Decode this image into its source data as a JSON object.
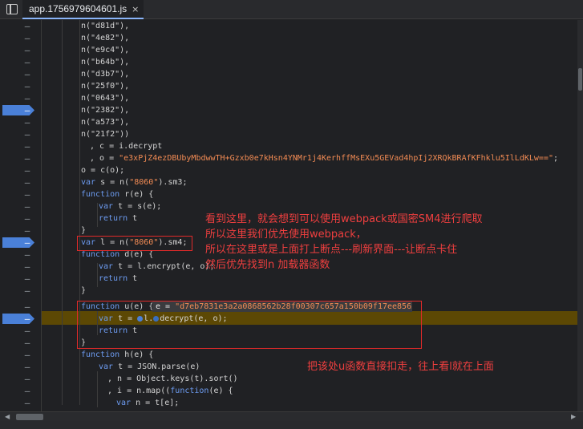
{
  "tab": {
    "filename": "app.1756979604601.js",
    "close_glyph": "×"
  },
  "gutter_mark": "–",
  "code": {
    "l1": "n(\"d81d\"),",
    "l2": "n(\"4e82\"),",
    "l3": "n(\"e9c4\"),",
    "l4": "n(\"b64b\"),",
    "l5": "n(\"d3b7\"),",
    "l6": "n(\"25f0\"),",
    "l7": "n(\"0643\"),",
    "l8": "n(\"2382\"),",
    "l9": "n(\"a573\"),",
    "l10": "n(\"21f2\"))",
    "l11_a": ", c = i.decrypt",
    "l12_a": ", o = ",
    "l12_str": "\"e3xPjZ4ezDBUbyMbdwwTH+Gzxb0e7kHsn4YNMr1j4KerhffMsEXu5GEVad4hpIj2XRQkBRAfKFhklu5IlLdKLw==\"",
    "l12_b": ";",
    "l13": "o = c(o);",
    "l14_kw": "var",
    "l14_a": " s = n(",
    "l14_str": "\"8060\"",
    "l14_b": ").sm3;",
    "l15_kw": "function",
    "l15_a": " r(e) {",
    "l16_kw": "var",
    "l16_a": " t = s(e);",
    "l17_kw": "return",
    "l17_a": " t",
    "l18": "}",
    "l19_kw": "var",
    "l19_a": " l = n(",
    "l19_str": "\"8060\"",
    "l19_b": ").sm4;",
    "l20_kw": "function",
    "l20_a": " d(e) {",
    "l21_kw": "var",
    "l21_a": " t = l.encrypt(e, o);",
    "l22_kw": "return",
    "l22_a": " t",
    "l23": "}",
    "l24_kw": "function",
    "l24_a": " u(e) {",
    "l25_kw": "var",
    "l25_a": " t = ",
    "l25_b": "l.",
    "l25_c": "decrypt(e, o);",
    "l26_kw": "return",
    "l26_a": " t",
    "l27": "}",
    "l28_kw": "function",
    "l28_a": " h(e) {",
    "l29_kw": "var",
    "l29_a": " t = JSON.parse(e)",
    "l30": ", n = Object.keys(t).sort()",
    "l31_a": ", i = n.map((",
    "l31_kw": "function",
    "l31_b": "(e) {",
    "l32_kw": "var",
    "l32_a": " n = t[e];"
  },
  "inline_value": {
    "label": "e = ",
    "value": "\"d7eb7831e3a2a0868562b28f00307c657a150b09f17ee8562"
  },
  "annotations": {
    "note1_line1": "看到这里，就会想到可以使用webpack或国密SM4进行爬取",
    "note1_line2": "所以这里我们优先使用webpack，",
    "note1_line3": "所以在这里或是上面打上断点---刷新界面---让断点卡住",
    "note1_line4": "然后优先找到n 加载器函数",
    "note2": "把该处u函数直接扣走，往上看l就在上面"
  },
  "colors": {
    "accent": "#8ab4f8",
    "annotation": "#e12a2a",
    "breakpoint": "#4a80d8",
    "paused_line": "#5c4804",
    "string": "#f28b54",
    "keyword": "#6d9cf2"
  }
}
